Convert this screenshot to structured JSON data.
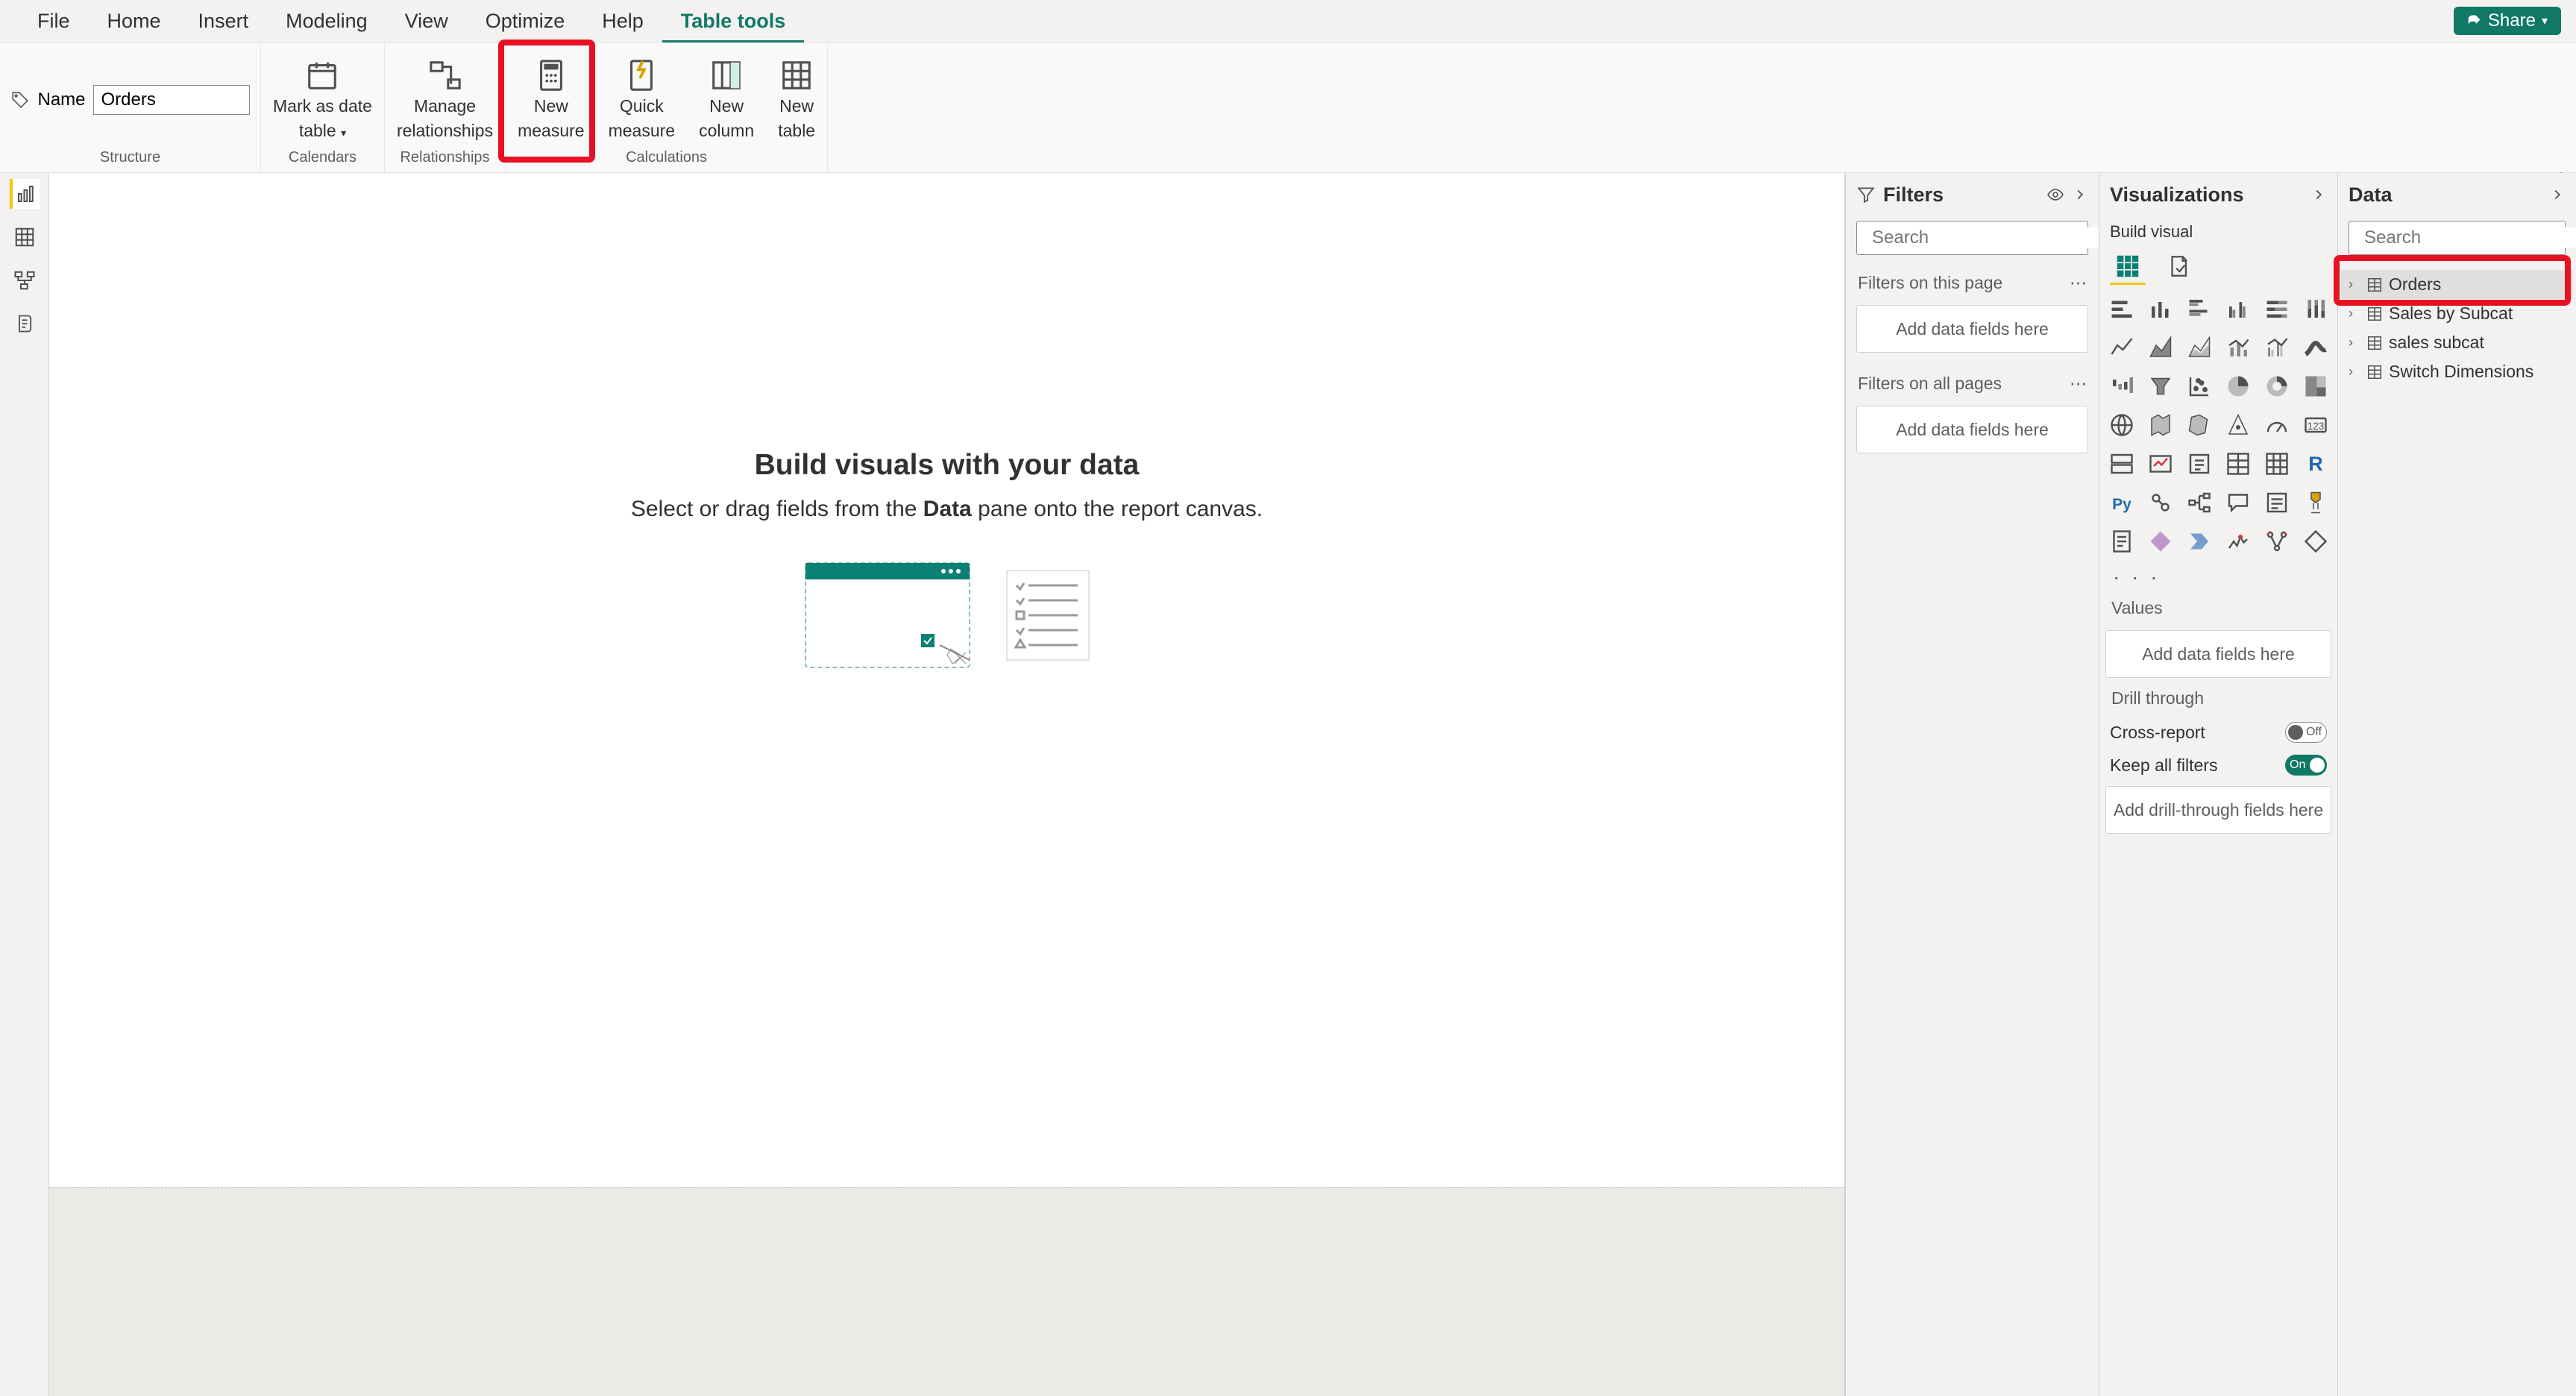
{
  "menubar": {
    "tabs": [
      "File",
      "Home",
      "Insert",
      "Modeling",
      "View",
      "Optimize",
      "Help",
      "Table tools"
    ],
    "active_tab": "Table tools",
    "share_label": "Share"
  },
  "ribbon": {
    "name_label": "Name",
    "name_value": "Orders",
    "groups": {
      "structure": "Structure",
      "calendars": "Calendars",
      "relationships": "Relationships",
      "calculations": "Calculations"
    },
    "buttons": {
      "mark_date_line1": "Mark as date",
      "mark_date_line2": "table",
      "manage_rel_line1": "Manage",
      "manage_rel_line2": "relationships",
      "new_measure_line1": "New",
      "new_measure_line2": "measure",
      "quick_measure_line1": "Quick",
      "quick_measure_line2": "measure",
      "new_column_line1": "New",
      "new_column_line2": "column",
      "new_table_line1": "New",
      "new_table_line2": "table"
    }
  },
  "canvas": {
    "title": "Build visuals with your data",
    "subtitle_pre": "Select or drag fields from the ",
    "subtitle_bold": "Data",
    "subtitle_post": " pane onto the report canvas."
  },
  "filters_pane": {
    "title": "Filters",
    "search_placeholder": "Search",
    "filters_page": "Filters on this page",
    "filters_all": "Filters on all pages",
    "drop_hint": "Add data fields here"
  },
  "viz_pane": {
    "title": "Visualizations",
    "build_visual": "Build visual",
    "values": "Values",
    "values_hint": "Add data fields here",
    "drill": "Drill through",
    "cross_report": "Cross-report",
    "keep_filters": "Keep all filters",
    "cross_report_state": "Off",
    "keep_filters_state": "On",
    "drill_hint": "Add drill-through fields here"
  },
  "data_pane": {
    "title": "Data",
    "search_placeholder": "Search",
    "tables": [
      {
        "name": "Orders",
        "selected": true
      },
      {
        "name": "Sales by Subcat",
        "selected": false
      },
      {
        "name": "sales subcat",
        "selected": false
      },
      {
        "name": "Switch Dimensions",
        "selected": false
      }
    ]
  },
  "annotations": {
    "highlight_new_measure": true,
    "highlight_orders_table": true
  }
}
